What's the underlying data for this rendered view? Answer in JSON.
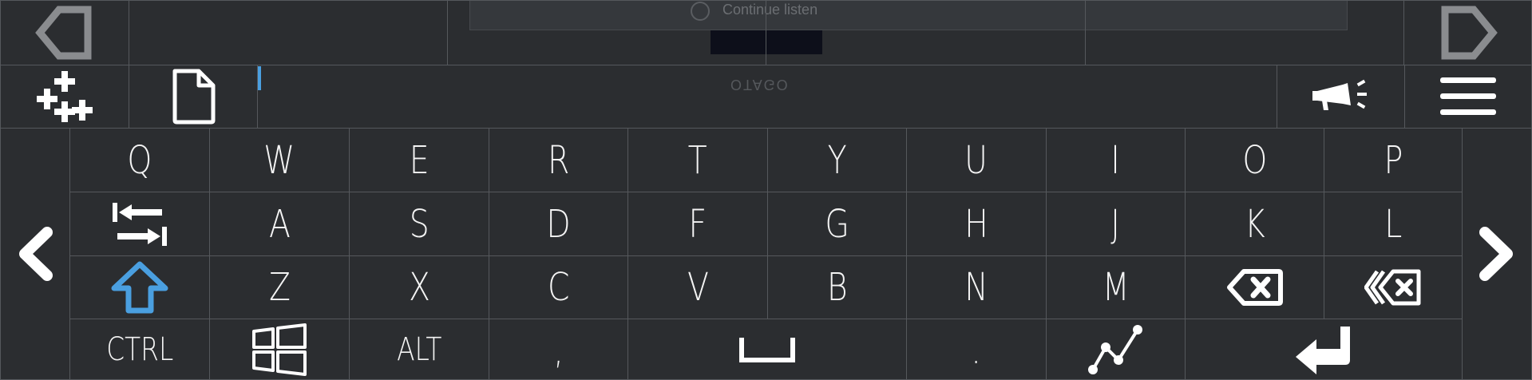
{
  "background_ghost": {
    "dialog_text": "Continue listen",
    "logo_text": "OTAGO"
  },
  "toolbar_top": {
    "prev_icon": "triangle-left-icon",
    "next_icon": "triangle-right-icon"
  },
  "toolbar": {
    "add_icon": "plus-cluster-icon",
    "file_icon": "document-icon",
    "input_value": "",
    "announce_icon": "megaphone-icon",
    "menu_icon": "hamburger-menu-icon"
  },
  "nav": {
    "left_icon": "chevron-left-icon",
    "right_icon": "chevron-right-icon"
  },
  "keyboard": {
    "row1": [
      "Q",
      "W",
      "E",
      "R",
      "T",
      "Y",
      "U",
      "I",
      "O",
      "P"
    ],
    "row2": [
      "A",
      "S",
      "D",
      "F",
      "G",
      "H",
      "J",
      "K",
      "L"
    ],
    "row3": [
      "Z",
      "X",
      "C",
      "V",
      "B",
      "N",
      "M"
    ],
    "row4": {
      "ctrl": "CTRL",
      "alt": "ALT",
      "comma": ",",
      "period": "."
    },
    "icons": {
      "tab": "tab-icon",
      "shift": "shift-icon",
      "backspace": "backspace-icon",
      "delete_word": "delete-word-icon",
      "windows": "windows-icon",
      "space": "space-icon",
      "swipe": "swipe-path-icon",
      "enter": "enter-icon"
    }
  },
  "colors": {
    "background": "#2b2d30",
    "border": "#55585c",
    "accent": "#4a9fe0",
    "key_text": "#f4f4f4"
  }
}
